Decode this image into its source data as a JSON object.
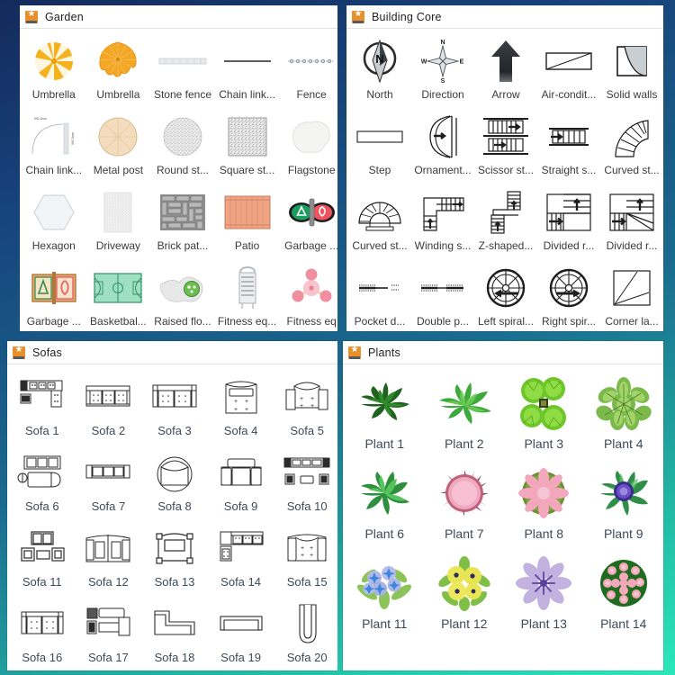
{
  "background": {
    "gradient_top": "#142a5c",
    "gradient_mid": "#1a6a8e",
    "gradient_bottom": "#2ae8bb"
  },
  "panels": [
    {
      "id": "garden",
      "title": "Garden",
      "icon": "favorites-star-icon",
      "columns": 5,
      "items": [
        {
          "label": "Umbrella",
          "icon": "umbrella-open-striped-icon"
        },
        {
          "label": "Umbrella",
          "icon": "umbrella-orange-icon"
        },
        {
          "label": "Stone fence",
          "icon": "stone-fence-icon"
        },
        {
          "label": "Chain link...",
          "icon": "chain-link-line-icon"
        },
        {
          "label": "Fence",
          "icon": "fence-dashed-icon"
        },
        {
          "label": "Chain link...",
          "icon": "chain-link-curve-dimension-icon",
          "dim_top": "992.2mm",
          "dim_side": "992.2mm"
        },
        {
          "label": "Metal post",
          "icon": "metal-post-round-icon"
        },
        {
          "label": "Round st...",
          "icon": "round-stone-icon"
        },
        {
          "label": "Square st...",
          "icon": "square-stone-icon"
        },
        {
          "label": "Flagstone",
          "icon": "flagstone-icon"
        },
        {
          "label": "Hexagon",
          "icon": "hexagon-paver-icon"
        },
        {
          "label": "Driveway",
          "icon": "driveway-icon"
        },
        {
          "label": "Brick pat...",
          "icon": "brick-pattern-icon"
        },
        {
          "label": "Patio",
          "icon": "patio-icon"
        },
        {
          "label": "Garbage ...",
          "icon": "garbage-bins-pair-icon"
        },
        {
          "label": "Garbage ...",
          "icon": "garbage-recycle-panel-icon"
        },
        {
          "label": "Basketbal...",
          "icon": "basketball-court-icon"
        },
        {
          "label": "Raised flo...",
          "icon": "raised-flower-bed-icon"
        },
        {
          "label": "Fitness eq...",
          "icon": "fitness-equipment-rack-icon"
        },
        {
          "label": "Fitness eq",
          "icon": "fitness-equipment-node-icon"
        }
      ]
    },
    {
      "id": "core",
      "title": "Building Core",
      "icon": "favorites-star-icon",
      "columns": 5,
      "items": [
        {
          "label": "North",
          "icon": "north-arrow-icon"
        },
        {
          "label": "Direction",
          "icon": "compass-rose-icon",
          "n": "N",
          "e": "E",
          "s": "S",
          "w": "W"
        },
        {
          "label": "Arrow",
          "icon": "arrow-up-icon"
        },
        {
          "label": "Air-condit...",
          "icon": "air-conditioning-duct-icon"
        },
        {
          "label": "Solid walls",
          "icon": "solid-walls-icon"
        },
        {
          "label": "Step",
          "icon": "step-icon"
        },
        {
          "label": "Ornament...",
          "icon": "ornamental-stair-icon"
        },
        {
          "label": "Scissor st...",
          "icon": "scissor-stair-icon"
        },
        {
          "label": "Straight s...",
          "icon": "straight-stair-icon"
        },
        {
          "label": "Curved st...",
          "icon": "curved-stair-quarter-icon"
        },
        {
          "label": "Curved st...",
          "icon": "curved-stair-half-icon"
        },
        {
          "label": "Winding s...",
          "icon": "winding-stair-icon"
        },
        {
          "label": "Z-shaped...",
          "icon": "z-shaped-stair-icon"
        },
        {
          "label": "Divided r...",
          "icon": "divided-return-stair-icon"
        },
        {
          "label": "Divided r...",
          "icon": "divided-return-stair-alt-icon"
        },
        {
          "label": "Pocket d...",
          "icon": "pocket-door-icon"
        },
        {
          "label": "Double p...",
          "icon": "double-pocket-door-icon"
        },
        {
          "label": "Left spiral...",
          "icon": "left-spiral-stair-icon"
        },
        {
          "label": "Right spir...",
          "icon": "right-spiral-stair-icon"
        },
        {
          "label": "Corner la...",
          "icon": "corner-landing-icon"
        }
      ]
    },
    {
      "id": "sofas",
      "title": "Sofas",
      "icon": "favorites-star-icon",
      "columns": 5,
      "items": [
        {
          "label": "Sofa 1",
          "icon": "sofa-l-sectional-icon"
        },
        {
          "label": "Sofa 2",
          "icon": "sofa-three-seat-icon"
        },
        {
          "label": "Sofa 3",
          "icon": "sofa-two-block-icon"
        },
        {
          "label": "Sofa 4",
          "icon": "sofa-armchair-wide-icon"
        },
        {
          "label": "Sofa 5",
          "icon": "sofa-round-back-icon"
        },
        {
          "label": "Sofa 6",
          "icon": "sofa-chaise-set-icon"
        },
        {
          "label": "Sofa 7",
          "icon": "sofa-long-three-icon"
        },
        {
          "label": "Sofa 8",
          "icon": "sofa-circular-icon"
        },
        {
          "label": "Sofa 9",
          "icon": "sofa-loveseat-icon"
        },
        {
          "label": "Sofa 10",
          "icon": "sofa-group-set-icon"
        },
        {
          "label": "Sofa 11",
          "icon": "sofa-living-set-icon"
        },
        {
          "label": "Sofa 12",
          "icon": "sofa-twin-sectional-icon"
        },
        {
          "label": "Sofa 13",
          "icon": "sofa-canopy-icon"
        },
        {
          "label": "Sofa 14",
          "icon": "sofa-corner-l-icon"
        },
        {
          "label": "Sofa 15",
          "icon": "sofa-padded-icon"
        },
        {
          "label": "Sofa 16",
          "icon": "sofa-double-seat-icon"
        },
        {
          "label": "Sofa 17",
          "icon": "sofa-lounge-group-icon"
        },
        {
          "label": "Sofa 18",
          "icon": "sofa-l-plain-icon"
        },
        {
          "label": "Sofa 19",
          "icon": "sofa-bench-icon"
        },
        {
          "label": "Sofa 20",
          "icon": "sofa-rounded-end-icon"
        }
      ]
    },
    {
      "id": "plants",
      "title": "Plants",
      "icon": "favorites-star-icon",
      "columns": 4,
      "items": [
        {
          "label": "Plant 1",
          "icon": "plant-dark-fern-icon",
          "color": "#2f7a2f"
        },
        {
          "label": "Plant 2",
          "icon": "plant-spiky-green-icon",
          "color": "#3aa03a"
        },
        {
          "label": "Plant 3",
          "icon": "plant-fan-cluster-icon",
          "color": "#66c22e"
        },
        {
          "label": "Plant 4",
          "icon": "plant-broad-leaf-icon",
          "color": "#8cc152"
        },
        {
          "label": "Plant 6",
          "icon": "plant-star-green-icon",
          "color": "#35a048"
        },
        {
          "label": "Plant 7",
          "icon": "plant-pink-thorn-icon",
          "color": "#f0a0bb"
        },
        {
          "label": "Plant 8",
          "icon": "plant-pink-bloom-icon",
          "color": "#f2a3bc"
        },
        {
          "label": "Plant 9",
          "icon": "plant-purple-bud-icon",
          "color": "#5d3fa8"
        },
        {
          "label": "Plant 11",
          "icon": "plant-blue-flowers-icon",
          "color": "#6aa8e8"
        },
        {
          "label": "Plant 12",
          "icon": "plant-yellow-flowers-icon",
          "color": "#e8e060"
        },
        {
          "label": "Plant 13",
          "icon": "plant-lilac-flower-icon",
          "color": "#b9a5de"
        },
        {
          "label": "Plant 14",
          "icon": "plant-pink-cluster-icon",
          "color": "#f4aebe"
        }
      ]
    }
  ]
}
